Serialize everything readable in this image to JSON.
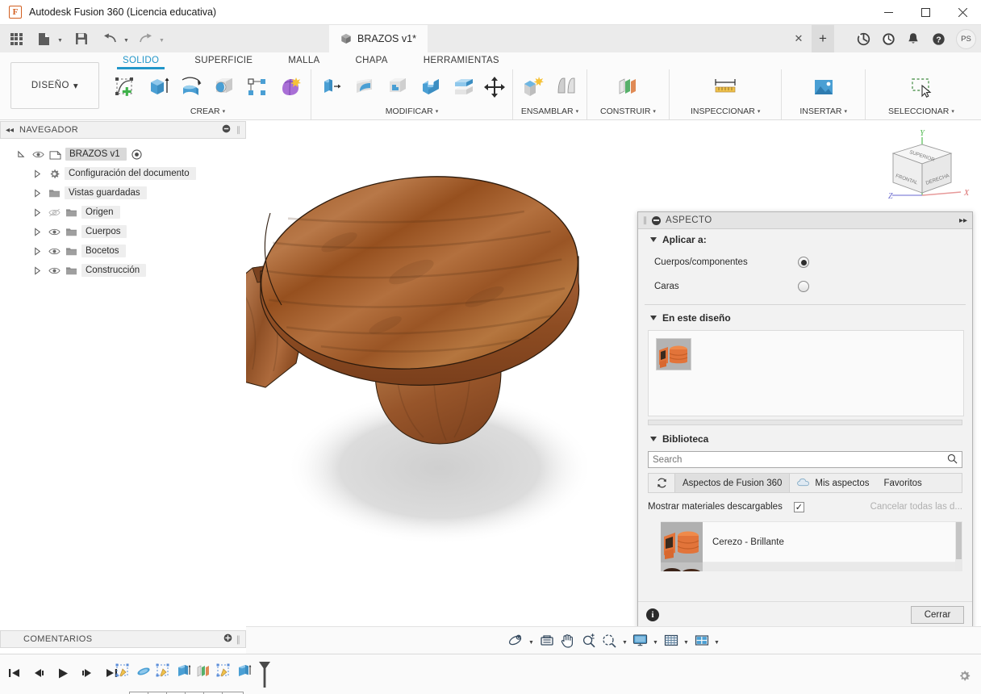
{
  "window": {
    "title": "Autodesk Fusion 360 (Licencia educativa)",
    "app_icon": "fusion-logo-icon",
    "minimize": "–",
    "maximize": "□",
    "close": "✕"
  },
  "quick_access": {
    "items": [
      {
        "name": "app-grid-icon",
        "label": ""
      },
      {
        "name": "new-file-icon",
        "label": ""
      },
      {
        "name": "save-icon",
        "label": ""
      },
      {
        "name": "undo-icon",
        "label": ""
      },
      {
        "name": "redo-icon",
        "label": ""
      }
    ]
  },
  "document_tab": {
    "title": "BRAZOS v1*",
    "icon": "cube-icon",
    "close": "✕",
    "new_tab": "+"
  },
  "header_actions": [
    {
      "name": "extensions-icon",
      "label": ""
    },
    {
      "name": "job-status-icon",
      "label": ""
    },
    {
      "name": "notifications-bell-icon",
      "label": ""
    },
    {
      "name": "help-icon",
      "label": ""
    }
  ],
  "account": {
    "initials": "PS"
  },
  "ribbon": {
    "workspace": {
      "label": "DISEÑO",
      "caret": "▾"
    },
    "tabs": [
      {
        "label": "SOLIDO",
        "active": true
      },
      {
        "label": "SUPERFICIE",
        "active": false
      },
      {
        "label": "MALLA",
        "active": false
      },
      {
        "label": "CHAPA",
        "active": false
      },
      {
        "label": "HERRAMIENTAS",
        "active": false
      }
    ],
    "panels": [
      {
        "label": "CREAR",
        "caret": "▾",
        "tools": [
          "new-sketch-icon",
          "extrude-icon",
          "revolve-icon",
          "sphere-icon",
          "pattern-icon",
          "form-icon"
        ]
      },
      {
        "label": "MODIFICAR",
        "caret": "▾",
        "tools": [
          "press-pull-icon",
          "fillet-icon",
          "shell-icon",
          "combine-icon",
          "split-body-icon",
          "move-copy-icon"
        ]
      },
      {
        "label": "ENSAMBLAR",
        "caret": "▾",
        "tools": [
          "new-component-icon",
          "joint-icon"
        ]
      },
      {
        "label": "CONSTRUIR",
        "caret": "▾",
        "tools": [
          "offset-plane-icon"
        ]
      },
      {
        "label": "INSPECCIONAR",
        "caret": "▾",
        "tools": [
          "measure-icon"
        ]
      },
      {
        "label": "INSERTAR",
        "caret": "▾",
        "tools": [
          "insert-image-icon"
        ]
      },
      {
        "label": "SELECCIONAR",
        "caret": "▾",
        "tools": [
          "selection-window-icon"
        ]
      }
    ]
  },
  "navigator": {
    "title": "NAVEGADOR",
    "collapse_icon": "◂◂",
    "minimize_icon": "minimize-icon",
    "grip_icon": "grip-icon",
    "root": {
      "label": "BRAZOS v1",
      "selected": true
    },
    "items": [
      {
        "label": "Configuración del documento",
        "icon": "gear-icon",
        "has_eye": false,
        "eye_off": false
      },
      {
        "label": "Vistas guardadas",
        "icon": "folder-icon",
        "has_eye": false,
        "eye_off": false
      },
      {
        "label": "Origen",
        "icon": "folder-icon",
        "has_eye": true,
        "eye_off": true
      },
      {
        "label": "Cuerpos",
        "icon": "folder-icon",
        "has_eye": true,
        "eye_off": false
      },
      {
        "label": "Bocetos",
        "icon": "folder-icon",
        "has_eye": true,
        "eye_off": false
      },
      {
        "label": "Construcción",
        "icon": "folder-icon",
        "has_eye": true,
        "eye_off": false
      }
    ]
  },
  "viewcube": {
    "faces": {
      "top": "SUPERIOR",
      "front": "FRONTAL",
      "right": "DERECHA"
    },
    "axes": {
      "x": "X",
      "y": "Y",
      "z": "Z"
    },
    "axis_colors": {
      "x": "#e8a0a0",
      "y": "#8fd58f",
      "z": "#8f8fd8"
    }
  },
  "model": {
    "name": "wooden-turned-part",
    "material_color": "#a6632f",
    "shadow_color": "#d9d9d9"
  },
  "dialog": {
    "title": "ASPECTO",
    "header_icon": "minimize-dot-icon",
    "expand_icon": "▸▸",
    "grip_icon": "grip-icon",
    "sections": {
      "apply_to": {
        "label": "Aplicar a:",
        "triangle": "▾",
        "options": [
          {
            "label": "Cuerpos/componentes",
            "selected": true
          },
          {
            "label": "Caras",
            "selected": false
          }
        ]
      },
      "in_this_design": {
        "label": "En este diseño",
        "triangle": "▾",
        "swatches": [
          {
            "name": "cerezo-brillante-swatch"
          }
        ]
      },
      "library": {
        "label": "Biblioteca",
        "triangle": "▾",
        "search": {
          "placeholder": "Search",
          "value": "",
          "icon": "search-icon"
        },
        "refresh_icon": "refresh-icon",
        "tabs": [
          {
            "label": "Aspectos de Fusion 360",
            "active": true,
            "icon": ""
          },
          {
            "label": "Mis aspectos",
            "active": false,
            "icon": "cloud-icon"
          },
          {
            "label": "Favoritos",
            "active": false,
            "icon": ""
          }
        ],
        "show_downloadable": {
          "label": "Mostrar materiales descargables",
          "checked": true,
          "check": "✓"
        },
        "cancel_all": "Cancelar todas las d...",
        "materials": [
          {
            "name": "Cerezo - Brillante",
            "thumb": "cherry-glossy-thumb"
          },
          {
            "name": "",
            "thumb": "dark-wood-thumb"
          }
        ]
      }
    },
    "footer": {
      "info_icon": "info-icon",
      "close_label": "Cerrar"
    }
  },
  "comments": {
    "label": "COMENTARIOS",
    "add_icon": "add-comment-icon",
    "grip_icon": "grip-icon"
  },
  "view_toolbar": {
    "items": [
      {
        "name": "orbit-icon",
        "caret": true
      },
      {
        "name": "look-at-icon",
        "caret": false
      },
      {
        "name": "pan-icon",
        "caret": false
      },
      {
        "name": "zoom-icon",
        "caret": false
      },
      {
        "name": "fit-icon",
        "caret": true
      },
      {
        "name": "display-settings-icon",
        "caret": true
      },
      {
        "name": "grid-snap-icon",
        "caret": true
      },
      {
        "name": "viewports-icon",
        "caret": true
      }
    ]
  },
  "timeline": {
    "playback": [
      {
        "name": "go-to-beginning-icon"
      },
      {
        "name": "step-back-icon"
      },
      {
        "name": "play-icon"
      },
      {
        "name": "step-forward-icon"
      },
      {
        "name": "go-to-end-icon"
      }
    ],
    "features": [
      {
        "name": "sketch-feature-icon"
      },
      {
        "name": "revolve-feature-icon"
      },
      {
        "name": "sketch-feature-icon"
      },
      {
        "name": "extrude-feature-icon"
      },
      {
        "name": "plane-feature-icon"
      },
      {
        "name": "sketch-feature-icon"
      },
      {
        "name": "extrude-feature-icon"
      }
    ],
    "marker": "timeline-marker-icon",
    "settings_icon": "gear-icon"
  }
}
